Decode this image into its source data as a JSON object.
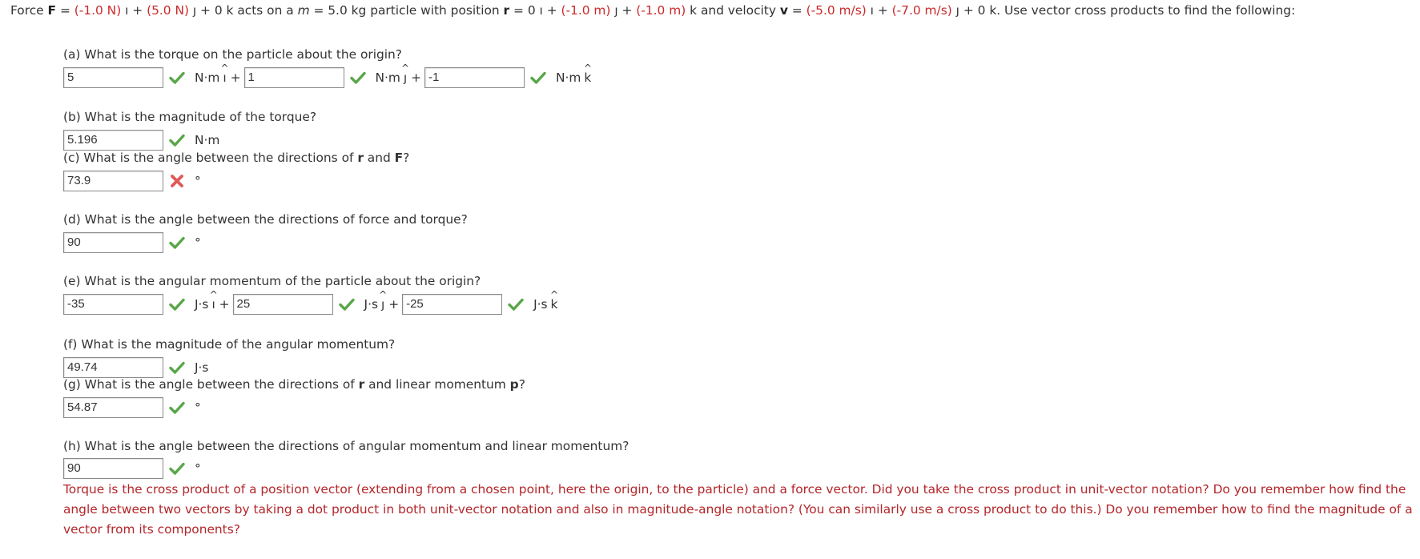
{
  "problem": {
    "p1": "Force ",
    "F": "F",
    "p2": " = ",
    "fx": "(-1.0 N)",
    "i_hat1": "ı",
    "p3": " + ",
    "fy": "(5.0 N)",
    "j_hat1": "ȷ",
    "p4": " + 0 ",
    "k_hat1": "k",
    "p5": " acts on a ",
    "m": "m",
    "p6": " = 5.0 kg particle with position ",
    "r": "r",
    "p7": " = 0 ",
    "i_hat2": "ı",
    "p8": " + ",
    "ry": "(-1.0 m)",
    "j_hat2": "ȷ",
    "p9": " + ",
    "rz": "(-1.0 m)",
    "k_hat2": "k",
    "p10": " and velocity ",
    "v": "v",
    "p11": " = ",
    "vx": "(-5.0 m/s)",
    "i_hat3": "ı",
    "p12": " + ",
    "vy": "(-7.0 m/s)",
    "j_hat3": "ȷ",
    "p13": " + 0 ",
    "k_hat3": "k",
    "p14": ". Use vector cross products to find the following:"
  },
  "parts": {
    "a": {
      "question": "(a) What is the torque on the particle about the origin?",
      "values": [
        "5",
        "1",
        "-1"
      ],
      "units": [
        "N·m",
        "N·m",
        "N·m"
      ],
      "unit_vectors": [
        "ı",
        "ȷ",
        "k"
      ],
      "plus": "+",
      "status": [
        "correct",
        "correct",
        "correct"
      ]
    },
    "b": {
      "question": "(b) What is the magnitude of the torque?",
      "value": "5.196",
      "unit": "N·m",
      "status": "correct"
    },
    "c": {
      "question_pre": "(c) What is the angle between the directions of ",
      "r": "r",
      "question_mid": " and ",
      "F": "F",
      "question_post": "?",
      "value": "73.9",
      "unit": "°",
      "status": "incorrect"
    },
    "d": {
      "question": "(d) What is the angle between the directions of force and torque?",
      "value": "90",
      "unit": "°",
      "status": "correct"
    },
    "e": {
      "question": "(e) What is the angular momentum of the particle about the origin?",
      "values": [
        "-35",
        "25",
        "-25"
      ],
      "units": [
        "J·s",
        "J·s",
        "J·s"
      ],
      "unit_vectors": [
        "ı",
        "ȷ",
        "k"
      ],
      "plus": "+",
      "status": [
        "correct",
        "correct",
        "correct"
      ]
    },
    "f": {
      "question": "(f) What is the magnitude of the angular momentum?",
      "value": "49.74",
      "unit": "J·s",
      "status": "correct"
    },
    "g": {
      "question_pre": "(g) What is the angle between the directions of ",
      "r": "r",
      "question_mid": " and linear momentum ",
      "p": "p",
      "question_post": "?",
      "value": "54.87",
      "unit": "°",
      "status": "correct"
    },
    "h": {
      "question": "(h) What is the angle between the directions of angular momentum and linear momentum?",
      "value": "90",
      "unit": "°",
      "status": "correct"
    }
  },
  "hint": "Torque is the cross product of a position vector (extending from a chosen point, here the origin, to the particle) and a force vector. Did you take the cross product in unit-vector notation? Do you remember how find the angle between two vectors by taking a dot product in both unit-vector notation and also in magnitude-angle notation? (You can similarly use a cross product to do this.) Do you remember how to find the magnitude of a vector from its components?",
  "colors": {
    "given_value": "#cc2a2a",
    "hint": "#b3262a",
    "correct": "#5aa64a",
    "incorrect": "#e05858"
  },
  "icons": {
    "correct": "check-icon",
    "incorrect": "x-icon"
  }
}
